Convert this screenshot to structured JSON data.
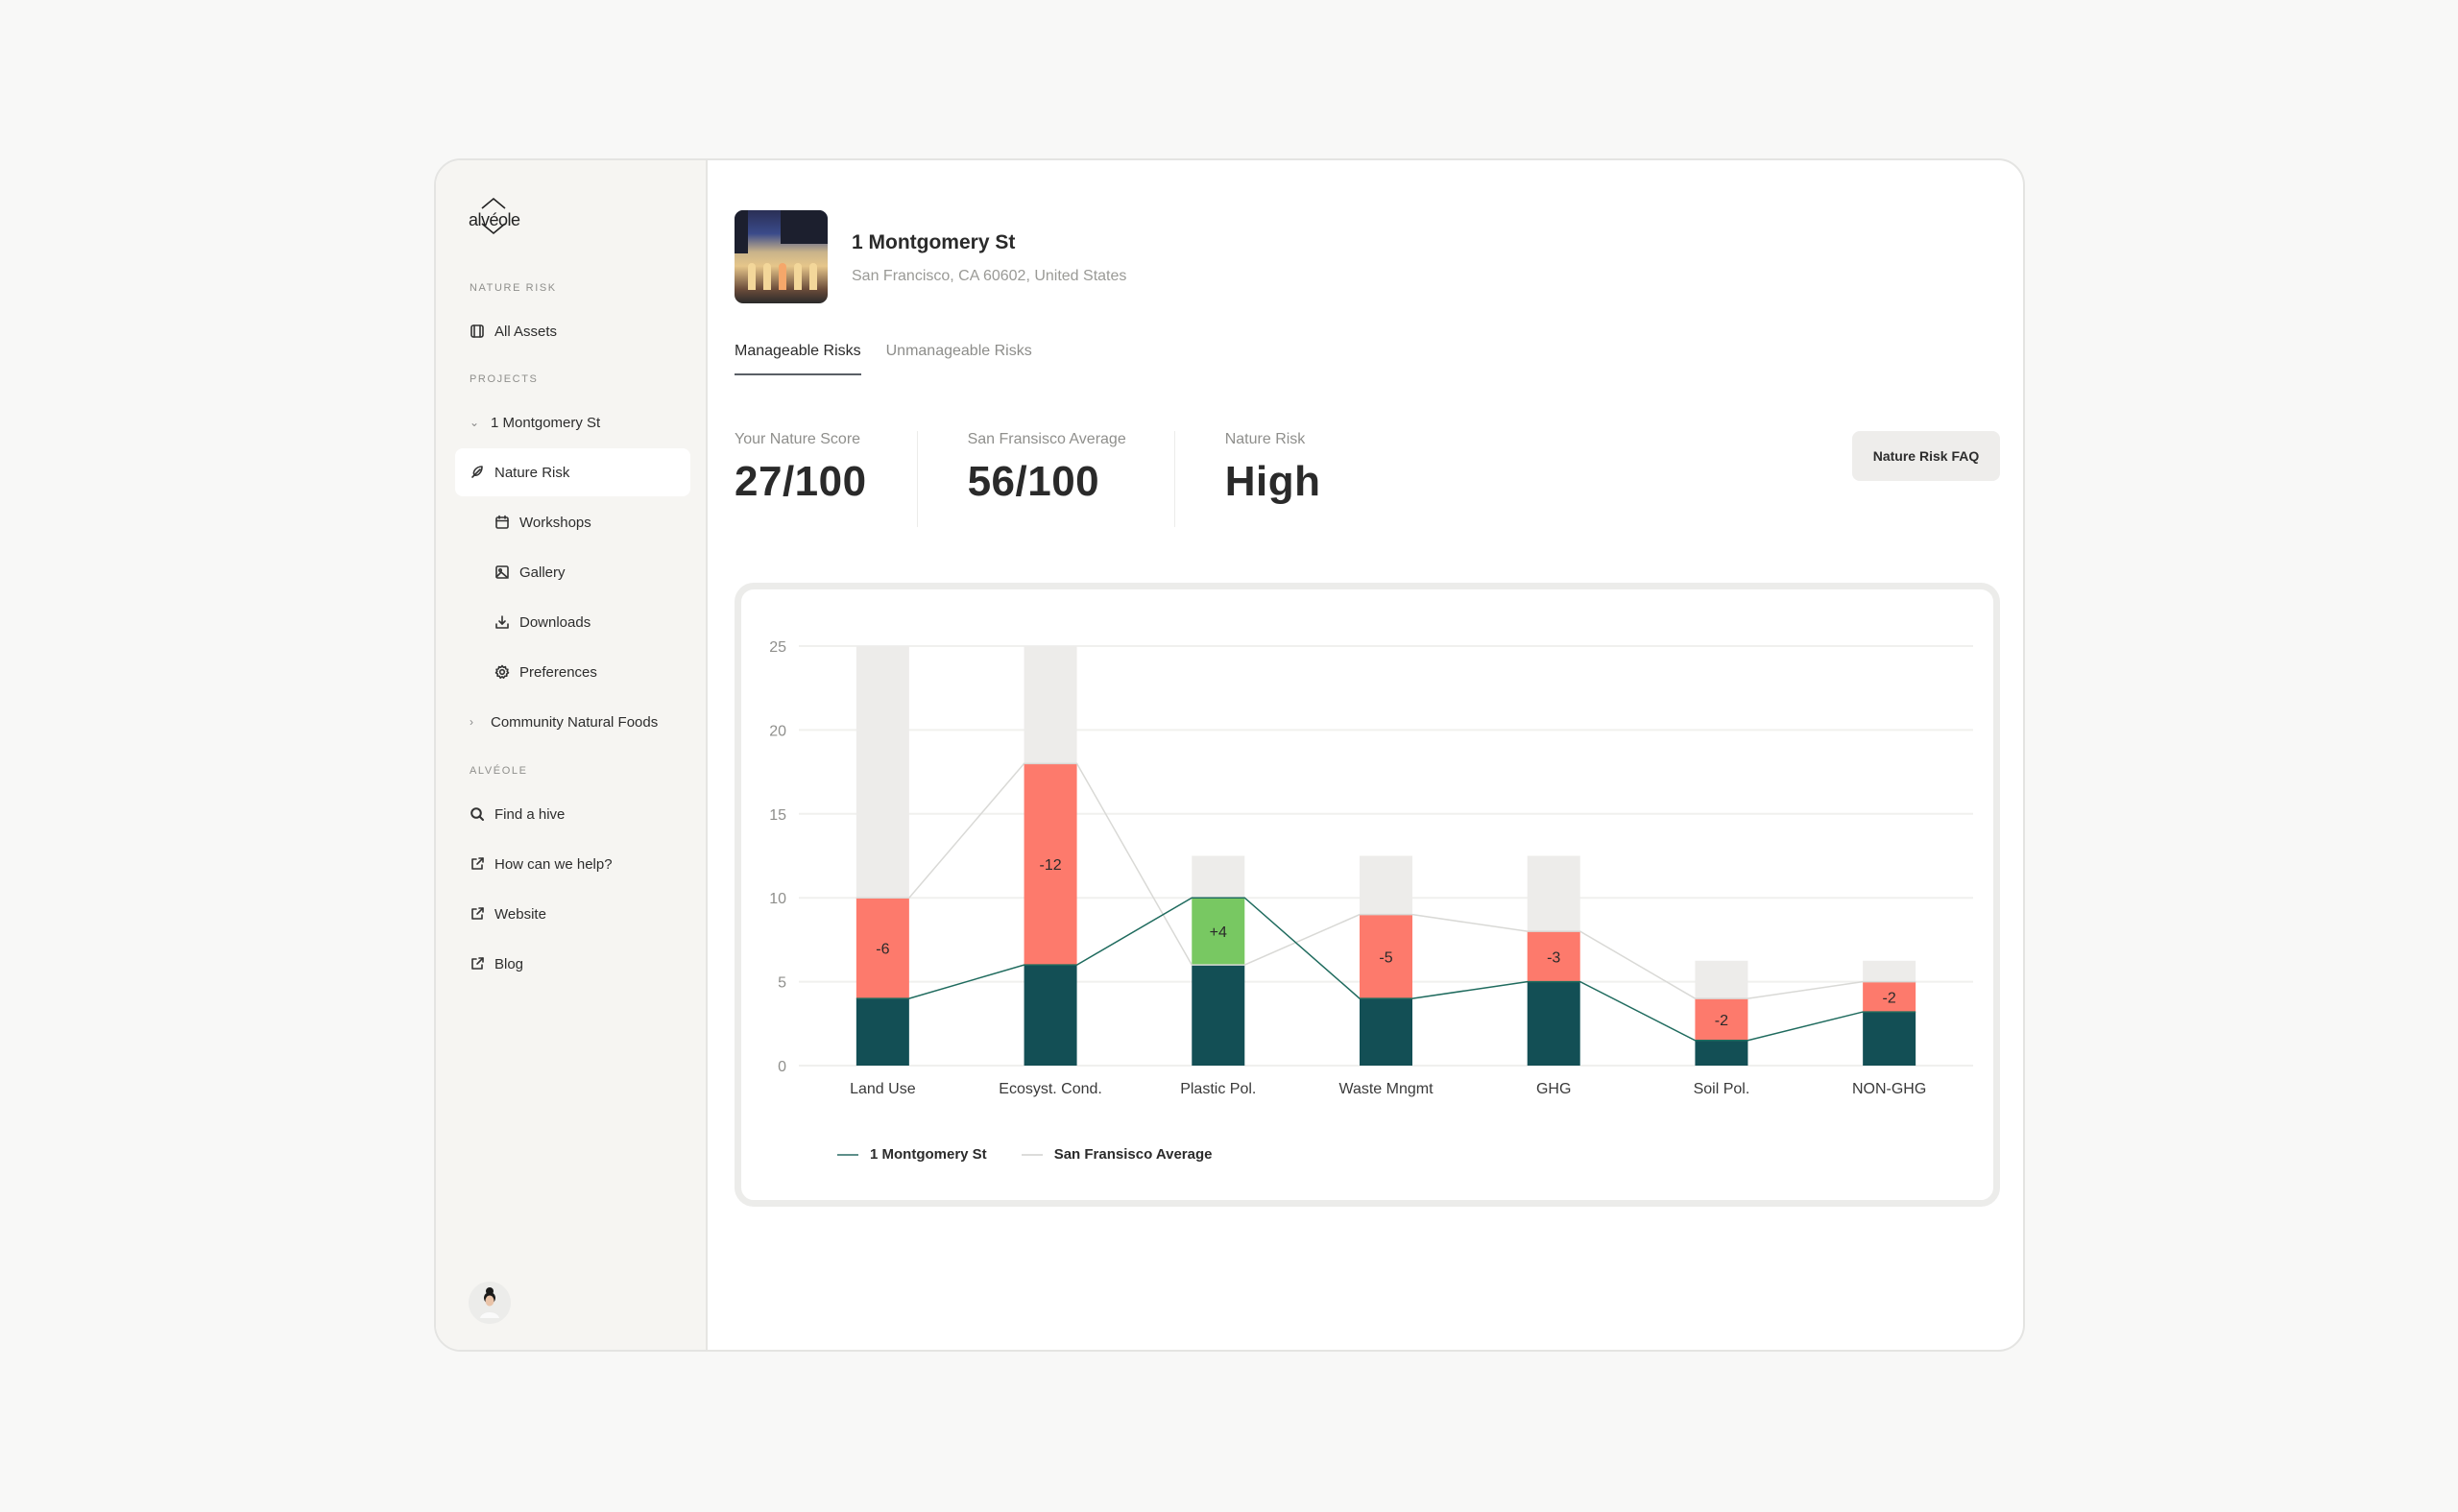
{
  "sidebar": {
    "logo": "alvéole",
    "sections": {
      "nature_risk": "NATURE RISK",
      "projects": "PROJECTS",
      "alveole": "ALVÉOLE"
    },
    "items": [
      {
        "label": "All Assets",
        "icon": "book-icon"
      },
      {
        "label": "1 Montgomery St",
        "icon": "chevron-down-icon"
      },
      {
        "label": "Nature Risk",
        "icon": "feather-icon",
        "active": true
      },
      {
        "label": "Workshops",
        "icon": "calendar-icon"
      },
      {
        "label": "Gallery",
        "icon": "image-icon"
      },
      {
        "label": "Downloads",
        "icon": "download-icon"
      },
      {
        "label": "Preferences",
        "icon": "gear-icon"
      },
      {
        "label": "Community Natural Foods",
        "icon": "chevron-right-icon"
      },
      {
        "label": "Find a hive",
        "icon": "search-icon"
      },
      {
        "label": "How can we help?",
        "icon": "external-link-icon"
      },
      {
        "label": "Website",
        "icon": "external-link-icon"
      },
      {
        "label": "Blog",
        "icon": "external-link-icon"
      }
    ]
  },
  "asset": {
    "title": "1 Montgomery St",
    "address": "San Francisco, CA 60602, United States"
  },
  "tabs": [
    {
      "label": "Manageable Risks",
      "active": true
    },
    {
      "label": "Unmanageable Risks",
      "active": false
    }
  ],
  "stats": [
    {
      "label": "Your Nature Score",
      "value": "27/100"
    },
    {
      "label": "San Fransisco Average",
      "value": "56/100"
    },
    {
      "label": "Nature Risk",
      "value": "High"
    }
  ],
  "faq_button": "Nature Risk FAQ",
  "colors": {
    "dark": "#134f55",
    "negative": "#fd7a6c",
    "positive": "#78c862",
    "remainder": "#edecea",
    "average_line": "#d9d9d6",
    "score_line": "#1f6b5e"
  },
  "chart_data": {
    "type": "bar",
    "stacked": true,
    "categories": [
      "Land Use",
      "Ecosyst. Cond.",
      "Plastic Pol.",
      "Waste Mngmt",
      "GHG",
      "Soil Pol.",
      "NON-GHG"
    ],
    "ylim": [
      0,
      25
    ],
    "yticks": [
      0,
      5,
      10,
      15,
      20,
      25
    ],
    "grid": true,
    "max_values": [
      25,
      25,
      12.5,
      12.5,
      12.5,
      6.25,
      6.25
    ],
    "series": [
      {
        "name": "1 Montgomery St",
        "values": [
          4,
          6,
          10,
          4,
          5,
          1.5,
          3.2
        ]
      },
      {
        "name": "San Fransisco Average",
        "values": [
          10,
          18,
          6,
          9,
          8,
          4,
          5
        ]
      }
    ],
    "difference_labels": [
      "-6",
      "-12",
      "+4",
      "-5",
      "-3",
      "-2",
      "-2"
    ],
    "legend": [
      "1 Montgomery St",
      "San Fransisco Average"
    ],
    "legend_position": "bottom-left"
  }
}
